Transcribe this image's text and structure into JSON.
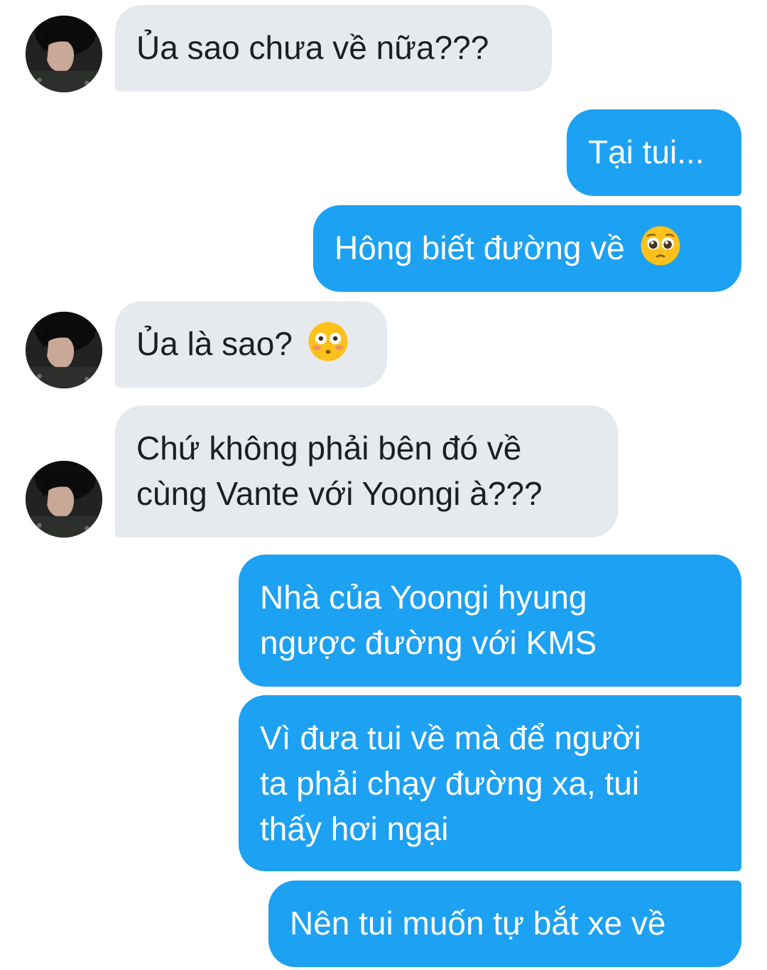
{
  "messages": [
    {
      "side": "in",
      "lines": [
        "Ủa sao chưa về nữa???"
      ]
    },
    {
      "side": "out",
      "lines": [
        "Tại tui..."
      ]
    },
    {
      "side": "out",
      "lines": [
        "Hông biết đường về"
      ],
      "emoji": "pleading-face-icon"
    },
    {
      "side": "in",
      "lines": [
        "Ủa là sao?"
      ],
      "emoji": "flushed-face-icon"
    },
    {
      "side": "in",
      "lines": [
        "Chứ không phải bên đó về",
        "cùng Vante với Yoongi à???"
      ]
    },
    {
      "side": "out",
      "lines": [
        "Nhà của Yoongi hyung",
        "ngược đường với KMS"
      ]
    },
    {
      "side": "out",
      "lines": [
        "Vì đưa tui về mà để người",
        "ta phải chạy đường xa, tui",
        "thấy hơi ngại"
      ]
    },
    {
      "side": "out",
      "lines": [
        "Nên tui muốn tự bắt xe về"
      ]
    }
  ],
  "avatar_icon": "user-avatar",
  "colors": {
    "incoming_bubble": "#e6e9ee",
    "outgoing_bubble": "#1da1f2",
    "incoming_text": "#1c1e21",
    "outgoing_text": "#ffffff"
  }
}
